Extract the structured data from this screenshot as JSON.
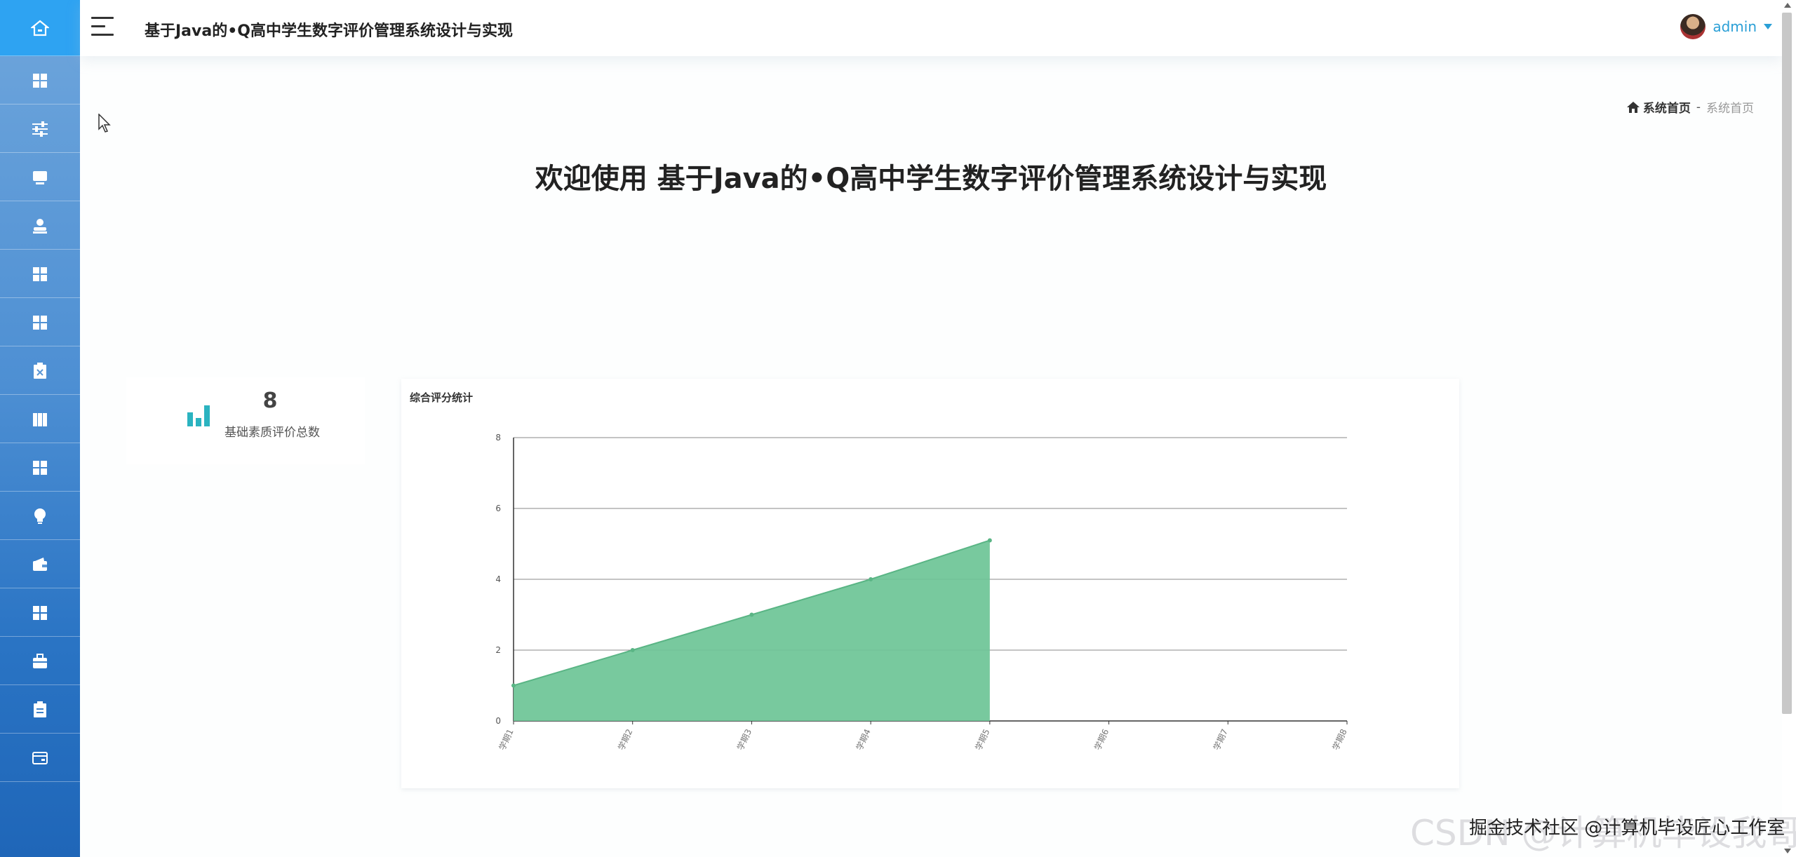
{
  "header": {
    "app_title": "基于Java的•Q高中学生数字评价管理系统设计与实现",
    "username": "admin"
  },
  "sidebar": {
    "items": [
      {
        "icon": "home-icon",
        "active": true
      },
      {
        "icon": "grid-icon"
      },
      {
        "icon": "sliders-icon"
      },
      {
        "icon": "monitor-icon"
      },
      {
        "icon": "user-icon"
      },
      {
        "icon": "grid-icon"
      },
      {
        "icon": "grid-icon"
      },
      {
        "icon": "clipboard-x-icon"
      },
      {
        "icon": "book-icon"
      },
      {
        "icon": "grid-icon"
      },
      {
        "icon": "lightbulb-icon"
      },
      {
        "icon": "wallet-icon"
      },
      {
        "icon": "grid-icon"
      },
      {
        "icon": "briefcase-icon"
      },
      {
        "icon": "clipboard-icon"
      },
      {
        "icon": "card-icon"
      }
    ]
  },
  "breadcrumb": {
    "home": "系统首页",
    "separator": "-",
    "current": "系统首页"
  },
  "welcome": "欢迎使用 基于Java的•Q高中学生数字评价管理系统设计与实现",
  "stat": {
    "value": "8",
    "label": "基础素质评价总数"
  },
  "colors": {
    "accent": "#2ea3f2",
    "stat_icon": "#2bb3c0",
    "area_fill": "#6cc496",
    "username": "#2a9fd6"
  },
  "watermark": {
    "large": "CSDN @计算机毕设我哥",
    "small": "掘金技术社区 @计算机毕设匠心工作室"
  },
  "chart_data": {
    "type": "area",
    "title": "综合评分统计",
    "categories": [
      "学期1",
      "学期2",
      "学期3",
      "学期4",
      "学期5",
      "学期6",
      "学期7",
      "学期8"
    ],
    "values": [
      1,
      2,
      3,
      4,
      5.1,
      null,
      null,
      null
    ],
    "ylim": [
      0,
      8
    ],
    "yticks": [
      0,
      2,
      4,
      6,
      8
    ],
    "grid": true,
    "xlabel": "",
    "ylabel": ""
  }
}
